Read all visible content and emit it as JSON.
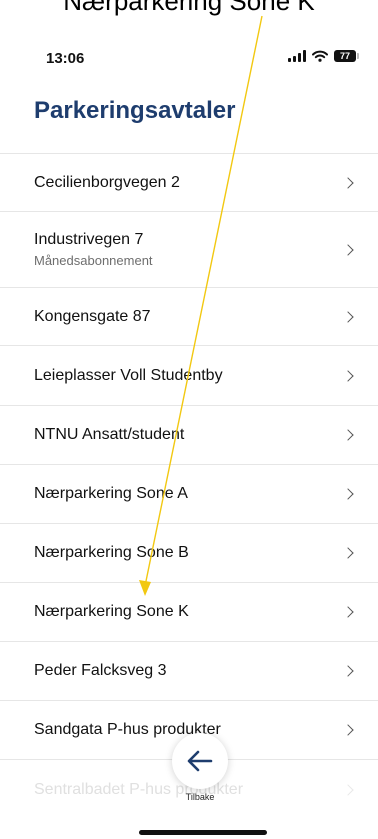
{
  "caption": "Nærparkering Sone K",
  "status_bar": {
    "time": "13:06",
    "battery": "77"
  },
  "page_title": "Parkeringsavtaler",
  "items": [
    {
      "title": "Cecilienborgvegen 2",
      "subtitle": ""
    },
    {
      "title": "Industrivegen 7",
      "subtitle": "Månedsabonnement"
    },
    {
      "title": "Kongensgate 87",
      "subtitle": ""
    },
    {
      "title": "Leieplasser Voll Studentby",
      "subtitle": ""
    },
    {
      "title": "NTNU Ansatt/student",
      "subtitle": ""
    },
    {
      "title": "Nærparkering Sone A",
      "subtitle": ""
    },
    {
      "title": "Nærparkering Sone B",
      "subtitle": ""
    },
    {
      "title": "Nærparkering Sone K",
      "subtitle": ""
    },
    {
      "title": "Peder Falcksveg 3",
      "subtitle": ""
    },
    {
      "title": "Sandgata P-hus produkter",
      "subtitle": ""
    },
    {
      "title": "Sentralbadet P-hus produkter",
      "subtitle": ""
    }
  ],
  "back_button": {
    "label": "Tilbake"
  },
  "colors": {
    "title": "#1e3d6e",
    "arrow": "#1e3d6e",
    "annotation": "#f2c811"
  },
  "icons": {
    "signal": "cellular-signal-icon",
    "wifi": "wifi-icon",
    "battery": "battery-icon",
    "chevron": "chevron-right-icon",
    "back": "arrow-left-icon"
  }
}
